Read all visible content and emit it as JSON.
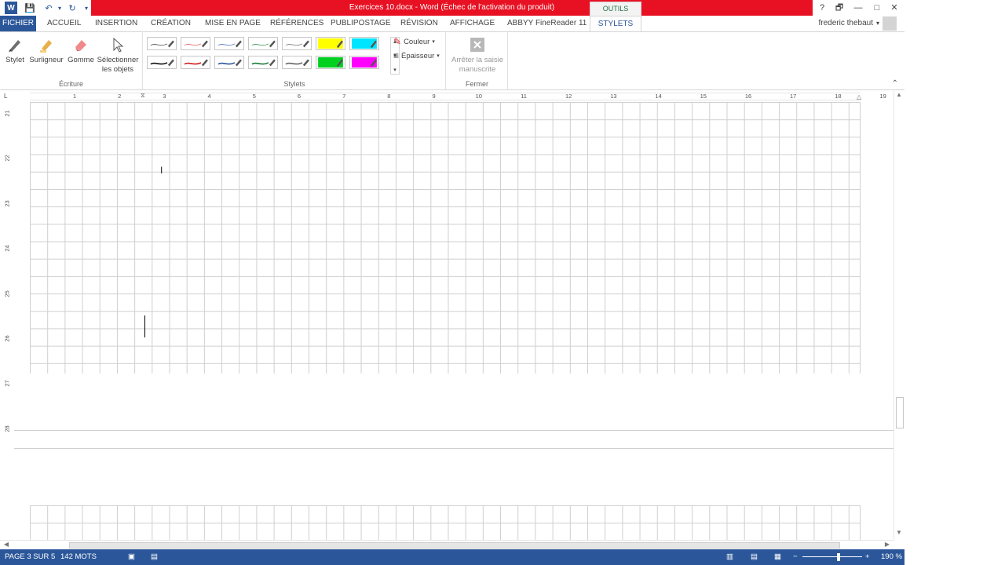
{
  "window": {
    "title": "Exercices 10.docx - Word (Échec de l'activation du produit)",
    "context_tab": "OUTILS ENCRE",
    "title_bar_color": "#e81123",
    "buttons": {
      "help": "?",
      "restore": "🗗",
      "minimize": "—",
      "maximize": "□",
      "close": "✕"
    }
  },
  "qat": {
    "app": "W",
    "save": "💾",
    "undo": "↶",
    "redo": "↻",
    "more": "▾"
  },
  "tabs": [
    {
      "label": "FICHIER"
    },
    {
      "label": "ACCUEIL"
    },
    {
      "label": "INSERTION"
    },
    {
      "label": "CRÉATION"
    },
    {
      "label": "MISE EN PAGE"
    },
    {
      "label": "RÉFÉRENCES"
    },
    {
      "label": "PUBLIPOSTAGE"
    },
    {
      "label": "RÉVISION"
    },
    {
      "label": "AFFICHAGE"
    },
    {
      "label": "ABBYY FineReader 11"
    },
    {
      "label": "STYLETS"
    }
  ],
  "user": {
    "name": "frederic thebaut",
    "dropdown": "▾"
  },
  "ribbon": {
    "ecriture": {
      "label": "Écriture",
      "stylet": "Stylet",
      "surligneur": "Surligneur",
      "gomme": "Gomme",
      "select_line1": "Sélectionner",
      "select_line2": "les objets"
    },
    "stylets": {
      "label": "Stylets",
      "couleur": "Couleur",
      "epaisseur": "Épaisseur",
      "pens": [
        {
          "color": "#444444",
          "kind": "thin"
        },
        {
          "color": "#e06060",
          "kind": "thin"
        },
        {
          "color": "#4a6fb5",
          "kind": "thin"
        },
        {
          "color": "#2f8f4f",
          "kind": "thin"
        },
        {
          "color": "#777777",
          "kind": "thin"
        },
        {
          "color": "#ffff00",
          "kind": "highlight"
        },
        {
          "color": "#00e5ff",
          "kind": "highlight"
        },
        {
          "color": "#111111",
          "kind": "thick"
        },
        {
          "color": "#d02020",
          "kind": "thick"
        },
        {
          "color": "#2b579a",
          "kind": "thick"
        },
        {
          "color": "#1f7a3a",
          "kind": "thick"
        },
        {
          "color": "#666666",
          "kind": "thick"
        },
        {
          "color": "#00d020",
          "kind": "highlight"
        },
        {
          "color": "#ff00ff",
          "kind": "highlight"
        }
      ]
    },
    "fermer": {
      "label": "Fermer",
      "stop_line1": "Arrêter la saisie",
      "stop_line2": "manuscrite"
    },
    "collapse": "⌃"
  },
  "ruler": {
    "numbers": [
      "1",
      "2",
      "3",
      "4",
      "5",
      "6",
      "7",
      "8",
      "9",
      "10",
      "11",
      "12",
      "13",
      "14",
      "15",
      "16",
      "17",
      "18",
      "19"
    ],
    "tab_selector": "L"
  },
  "vruler": {
    "numbers": [
      "21",
      "22",
      "23",
      "24",
      "25",
      "26",
      "27",
      "28"
    ]
  },
  "status": {
    "page": "PAGE 3 SUR 5",
    "words": "142 MOTS",
    "zoom": "190 %",
    "zoom_minus": "−",
    "zoom_plus": "+"
  }
}
